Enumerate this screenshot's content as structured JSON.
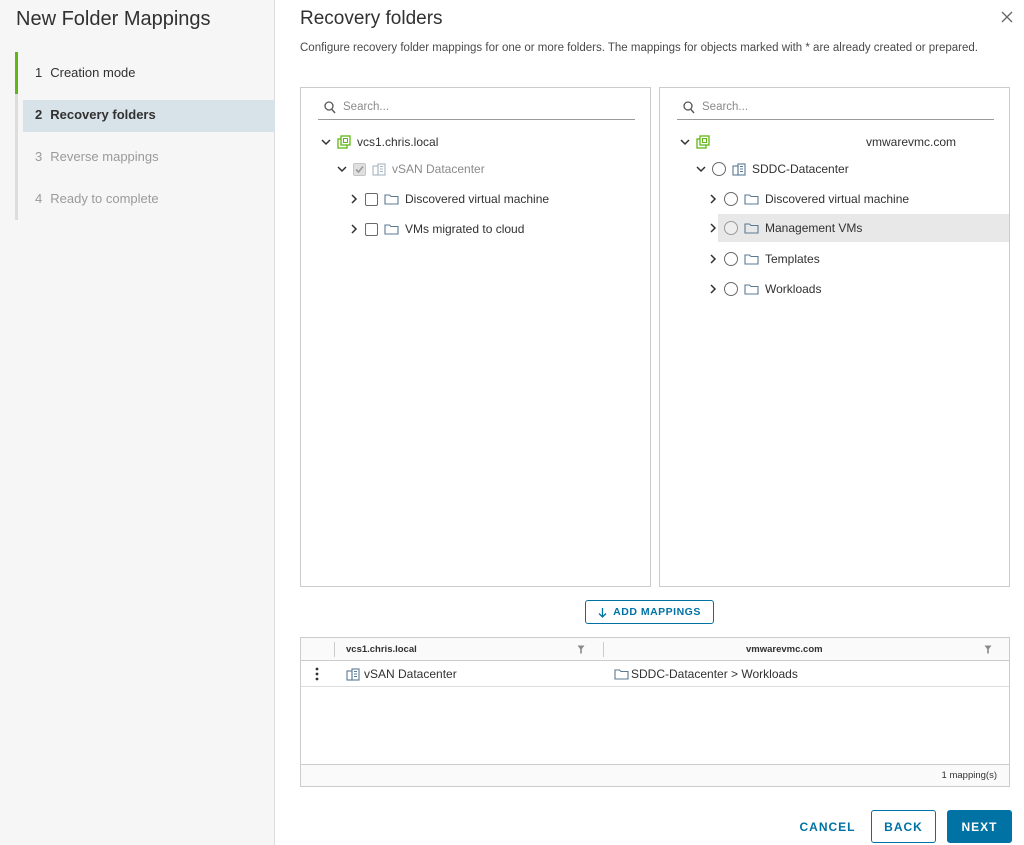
{
  "wizard": {
    "title": "New Folder Mappings",
    "steps": [
      {
        "num": "1",
        "label": "Creation mode",
        "state": "done"
      },
      {
        "num": "2",
        "label": "Recovery folders",
        "state": "active"
      },
      {
        "num": "3",
        "label": "Reverse mappings",
        "state": "disabled"
      },
      {
        "num": "4",
        "label": "Ready to complete",
        "state": "disabled"
      }
    ]
  },
  "page": {
    "title": "Recovery folders",
    "description": "Configure recovery folder mappings for one or more folders. The mappings for objects marked with * are already created or prepared."
  },
  "left_tree": {
    "search_placeholder": "Search...",
    "vcenter": "vcs1.chris.local",
    "datacenter": "vSAN Datacenter",
    "folders": [
      "Discovered virtual machine",
      "VMs migrated to cloud"
    ]
  },
  "right_tree": {
    "search_placeholder": "Search...",
    "vcenter": "vmwarevmc.com",
    "datacenter": "SDDC-Datacenter",
    "folders": [
      "Discovered virtual machine",
      "Management VMs",
      "Templates",
      "Workloads"
    ],
    "highlighted": "Management VMs"
  },
  "add_mappings_label": "ADD MAPPINGS",
  "grid": {
    "columns": [
      "vcs1.chris.local",
      "vmwarevmc.com"
    ],
    "rows": [
      {
        "source": "vSAN Datacenter",
        "target": "SDDC-Datacenter > Workloads"
      }
    ],
    "footer": "1 mapping(s)"
  },
  "buttons": {
    "cancel": "CANCEL",
    "back": "BACK",
    "next": "NEXT"
  },
  "colors": {
    "accent": "#0072a3",
    "done_green": "#5eb715",
    "active_step_bg": "#d8e3e9"
  }
}
